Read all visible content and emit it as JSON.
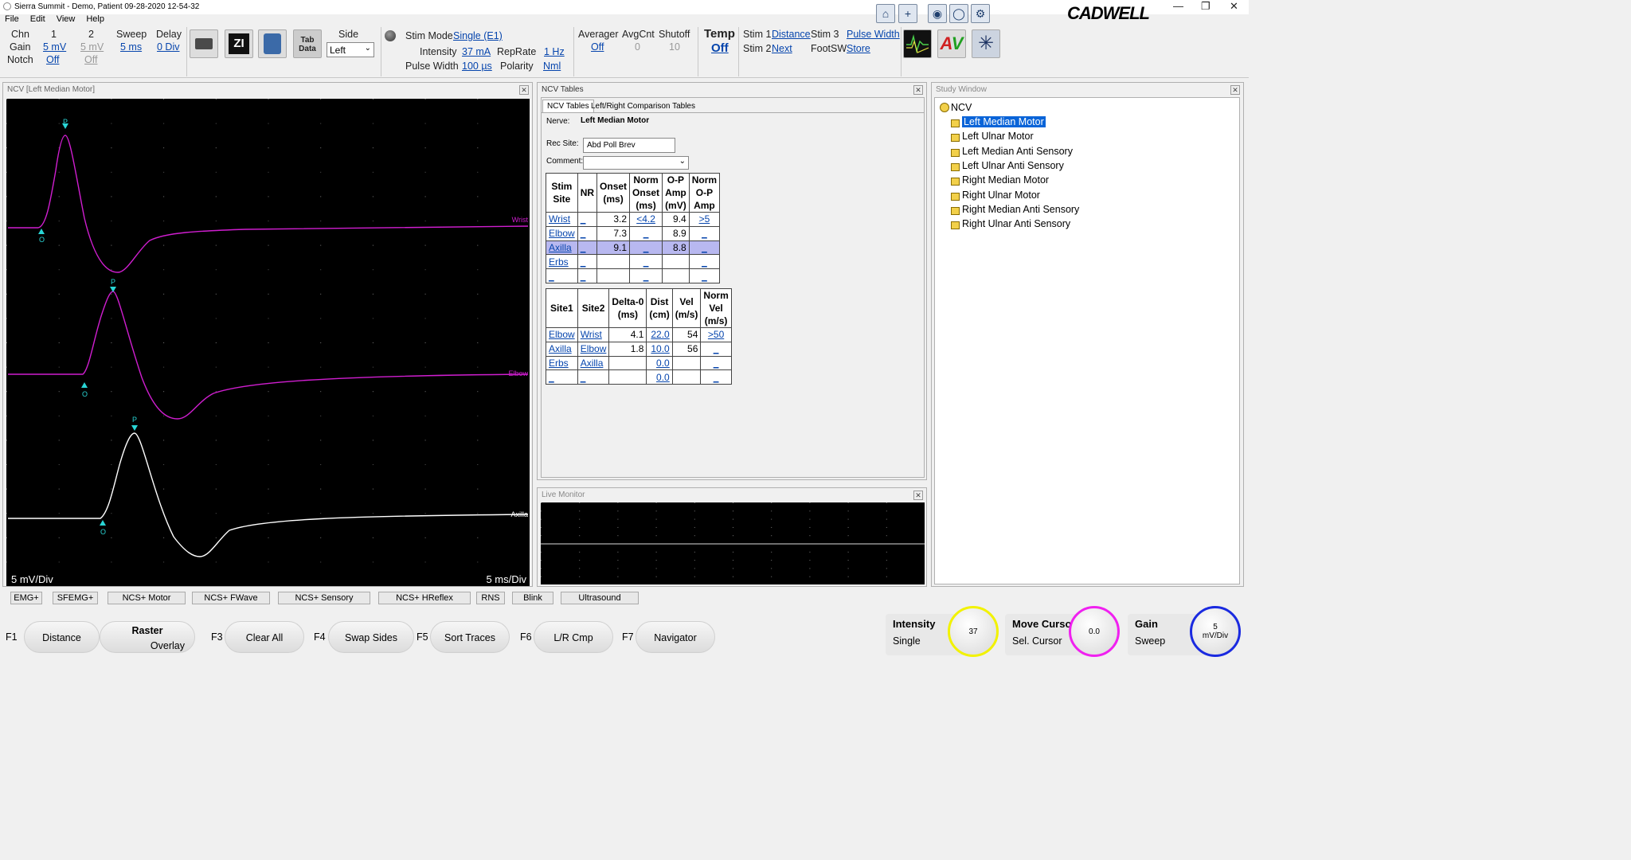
{
  "titlebar": {
    "title": "Sierra Summit - Demo, Patient 09-28-2020 12-54-32",
    "brand": "CADWELL"
  },
  "menu": [
    "File",
    "Edit",
    "View",
    "Help"
  ],
  "toolbar": {
    "chn_label": "Chn",
    "gain_label": "Gain",
    "notch_label": "Notch",
    "ch1": "1",
    "ch2": "2",
    "gain1": "5 mV",
    "gain2": "5 mV",
    "notch1": "Off",
    "notch2": "Off",
    "sweep_label": "Sweep",
    "sweep_value": "5 ms",
    "delay_label": "Delay",
    "delay_value": "0 Div",
    "side_label": "Side",
    "side_value": "Left",
    "stim_mode_label": "Stim Mode",
    "stim_mode_value": "Single (E1)",
    "intensity_label": "Intensity",
    "intensity_value": "37 mA",
    "reprate_label": "RepRate",
    "reprate_value": "1 Hz",
    "pulsewidth_label": "Pulse Width",
    "pulsewidth_value": "100 µs",
    "polarity_label": "Polarity",
    "polarity_value": "Nml",
    "averager_label": "Averager",
    "averager_value": "Off",
    "avgcnt_label": "AvgCnt",
    "avgcnt_value": "0",
    "shutoff_label": "Shutoff",
    "shutoff_value": "10",
    "temp_label": "Temp",
    "temp_value": "Off",
    "stim1_label": "Stim 1",
    "stim1_value": "Distance",
    "stim3_label": "Stim 3",
    "stim3_value": "Pulse Width",
    "stim2_label": "Stim 2",
    "stim2_value": "Next",
    "footsw_label": "FootSW",
    "footsw_value": "Store",
    "tab_data": "Tab Data",
    "zi": "ZI"
  },
  "waveform": {
    "title": "NCV [Left Median Motor]",
    "left_scale": "5 mV/Div",
    "right_scale": "5 ms/Div",
    "traces": [
      {
        "label": "Wrist",
        "color": "#d01ed0"
      },
      {
        "label": "Elbow",
        "color": "#d01ed0"
      },
      {
        "label": "Axilla",
        "color": "#ffffff"
      }
    ],
    "marker_onset": "O",
    "marker_peak": "P"
  },
  "ncv_tables": {
    "panel_title": "NCV Tables",
    "tabs": [
      "NCV Tables",
      "Left/Right Comparison Tables"
    ],
    "nerve_label": "Nerve:",
    "nerve_value": "Left Median Motor",
    "recsite_label": "Rec Site:",
    "recsite_value": "Abd Poll Brev",
    "comment_label": "Comment:",
    "table1": {
      "headers": [
        "Stim\nSite",
        "NR",
        "Onset\n(ms)",
        "Norm\nOnset\n(ms)",
        "O-P\nAmp\n(mV)",
        "Norm\nO-P\nAmp"
      ],
      "rows": [
        [
          "Wrist",
          "_",
          "3.2",
          "<4.2",
          "9.4",
          ">5"
        ],
        [
          "Elbow",
          "_",
          "7.3",
          "_",
          "8.9",
          "_"
        ],
        [
          "Axilla",
          "_",
          "9.1",
          "_",
          "8.8",
          "_"
        ],
        [
          "Erbs",
          "_",
          "",
          "_",
          "",
          "_"
        ],
        [
          "_",
          "_",
          "",
          "_",
          "",
          "_"
        ]
      ]
    },
    "table2": {
      "headers": [
        "Site1",
        "Site2",
        "Delta-0\n(ms)",
        "Dist\n(cm)",
        "Vel\n(m/s)",
        "Norm\nVel\n(m/s)"
      ],
      "rows": [
        [
          "Elbow",
          "Wrist",
          "4.1",
          "22.0",
          "54",
          ">50"
        ],
        [
          "Axilla",
          "Elbow",
          "1.8",
          "10.0",
          "56",
          "_"
        ],
        [
          "Erbs",
          "Axilla",
          "",
          "0.0",
          "",
          "_"
        ],
        [
          "_",
          "_",
          "",
          "0.0",
          "",
          "_"
        ]
      ]
    }
  },
  "live_monitor": {
    "title": "Live Monitor"
  },
  "study_window": {
    "title": "Study Window",
    "root": "NCV",
    "items": [
      "Left Median Motor",
      "Left Ulnar Motor",
      "Left Median Anti Sensory",
      "Left Ulnar Anti Sensory",
      "Right Median Motor",
      "Right Ulnar Motor",
      "Right Median Anti Sensory",
      "Right Ulnar Anti Sensory"
    ],
    "selected": "Left Median Motor"
  },
  "modes": [
    "EMG+",
    "SFEMG+",
    "NCS+ Motor",
    "NCS+ FWave",
    "NCS+ Sensory",
    "NCS+ HReflex",
    "RNS",
    "Blink",
    "Ultrasound"
  ],
  "fkeys": [
    {
      "key": "F1",
      "label": "Distance"
    },
    {
      "key": "F2",
      "label": "Raster",
      "sub": "Overlay"
    },
    {
      "key": "F3",
      "label": "Clear All"
    },
    {
      "key": "F4",
      "label": "Swap Sides"
    },
    {
      "key": "F5",
      "label": "Sort Traces"
    },
    {
      "key": "F6",
      "label": "L/R Cmp"
    },
    {
      "key": "F7",
      "label": "Navigator"
    }
  ],
  "knobs": [
    {
      "title": "Intensity",
      "mode": "Single",
      "value": "37",
      "color": "#f2f200"
    },
    {
      "title": "Move Curso",
      "mode": "Sel. Cursor",
      "value": "0.0",
      "color": "#f020f0"
    },
    {
      "title": "Gain",
      "mode": "Sweep",
      "value": "5\nmV/Div",
      "color": "#1a2ae0"
    }
  ]
}
